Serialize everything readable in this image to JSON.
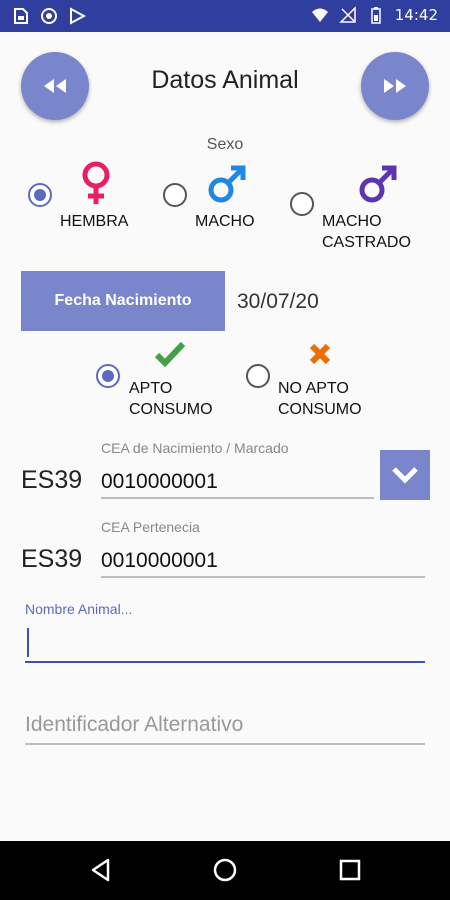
{
  "status_bar": {
    "time": "14:42",
    "left_icons": [
      "sd-card-icon",
      "circle-icon",
      "play-store-icon"
    ],
    "right_icons": [
      "wifi-icon",
      "no-signal-icon",
      "battery-icon"
    ]
  },
  "header": {
    "title": "Datos Animal",
    "prev_icon": "rewind-icon",
    "next_icon": "fast-forward-icon"
  },
  "sexo": {
    "label": "Sexo",
    "options": [
      {
        "label": "HEMBRA",
        "selected": true,
        "icon": "female-icon",
        "color": "#e91e63"
      },
      {
        "label": "MACHO",
        "selected": false,
        "icon": "male-icon",
        "color": "#1e88e5"
      },
      {
        "label_line1": "MACHO",
        "label_line2": "CASTRADO",
        "selected": false,
        "icon": "male-icon",
        "color": "#5e35b1"
      }
    ]
  },
  "fecha": {
    "button_label": "Fecha Nacimiento",
    "value": "30/07/20"
  },
  "consumo": {
    "options": [
      {
        "label_line1": "APTO",
        "label_line2": "CONSUMO",
        "selected": true,
        "icon": "check-icon",
        "color": "#43a047"
      },
      {
        "label_line1": "NO APTO",
        "label_line2": "CONSUMO",
        "selected": false,
        "icon": "cross-icon",
        "color": "#ef6c00"
      }
    ]
  },
  "cea_nacimiento": {
    "prefix": "ES39",
    "label": "CEA de Nacimiento / Marcado",
    "value": "0010000001"
  },
  "cea_pertenencia": {
    "prefix": "ES39",
    "label": "CEA Pertenecia",
    "value": "0010000001"
  },
  "nombre": {
    "label": "Nombre Animal...",
    "value": ""
  },
  "identificador": {
    "placeholder": "Identificador Alternativo"
  },
  "colors": {
    "status_bar": "#303f9f",
    "accent": "#7986cb",
    "focus": "#3f51b5"
  }
}
